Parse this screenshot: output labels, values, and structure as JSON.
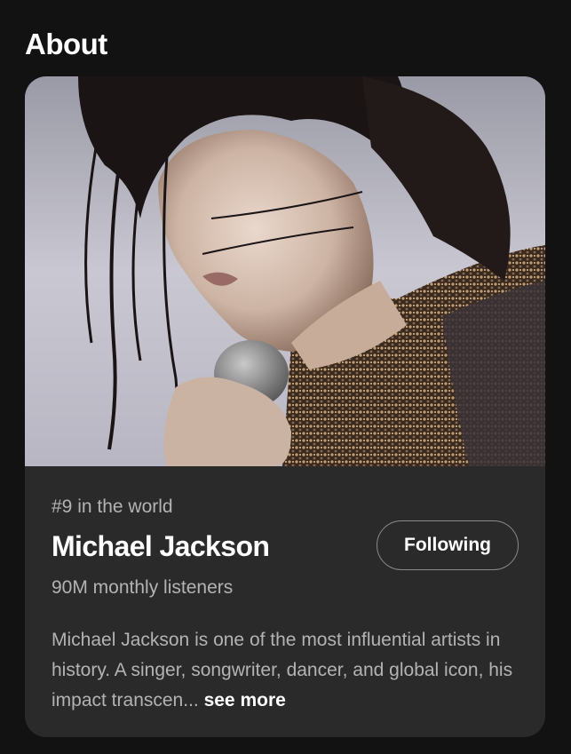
{
  "section": {
    "title": "About"
  },
  "artist": {
    "rank": "#9 in the world",
    "name": "Michael Jackson",
    "listeners": "90M monthly listeners",
    "follow_label": "Following",
    "bio": "Michael Jackson is one of the most influential artists in history. A singer, songwriter, dancer, and global icon, his impact transcen...",
    "see_more_label": "see more"
  },
  "colors": {
    "background": "#121212",
    "card": "#2a2a2a",
    "secondary_text": "#b3b3b3"
  }
}
